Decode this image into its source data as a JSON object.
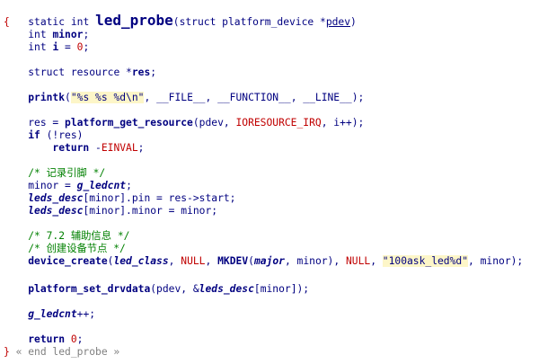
{
  "code": {
    "l0": {
      "static_kw": "static",
      "int_kw": "int",
      "fn_name": "led_probe",
      "params_open": "(struct platform_device *",
      "param": "pdev",
      "params_close": ")"
    },
    "l1": {
      "text": "{"
    },
    "l2": {
      "type": "int",
      "name": "minor",
      "semi": ";"
    },
    "l3": {
      "type": "int",
      "name": "i",
      "eq": " = ",
      "val": "0",
      "semi": ";"
    },
    "l5": {
      "kw": "struct",
      "type": " resource *",
      "name": "res",
      "semi": ";"
    },
    "l7": {
      "fn": "printk",
      "open": "(",
      "str": "\"%s %s %d\\n\"",
      "args": ", __FILE__, __FUNCTION__, __LINE__);"
    },
    "l9": {
      "lhs": "res = ",
      "fn": "platform_get_resource",
      "open": "(pdev, ",
      "const": "IORESOURCE_IRQ",
      "close": ", i++);"
    },
    "l10": {
      "kw": "if",
      "rest": " (!res)"
    },
    "l11": {
      "kw": "return",
      "minus": " -",
      "const": "EINVAL",
      "semi": ";"
    },
    "l13": {
      "comment": "/* 记录引脚 */"
    },
    "l14": {
      "lhs": "minor = ",
      "gl": "g_ledcnt",
      "semi": ";"
    },
    "l15": {
      "gl": "leds_desc",
      "rest": "[minor].pin = res->start;"
    },
    "l16": {
      "gl": "leds_desc",
      "rest": "[minor].minor = minor;"
    },
    "l18": {
      "comment": "/* 7.2 辅助信息 */"
    },
    "l19": {
      "comment": "/* 创建设备节点 */"
    },
    "l20": {
      "fn": "device_create",
      "open": "(",
      "gl1": "led_class",
      "sep1": ", ",
      "null1": "NULL",
      "sep2": ", ",
      "fn2": "MKDEV",
      "open2": "(",
      "gl2": "major",
      "sep3": ", minor), ",
      "null2": "NULL",
      "sep4": ", ",
      "str": "\"100ask_led%d\"",
      "close": ", minor);"
    },
    "l22": {
      "fn": "platform_set_drvdata",
      "open": "(pdev, &",
      "gl": "leds_desc",
      "close": "[minor]);"
    },
    "l24": {
      "gl": "g_ledcnt",
      "rest": "++;"
    },
    "l26": {
      "kw": "return",
      "val": " 0",
      "semi": ";"
    },
    "l27": {
      "brace": "}",
      "end": " « end led_probe »"
    }
  }
}
